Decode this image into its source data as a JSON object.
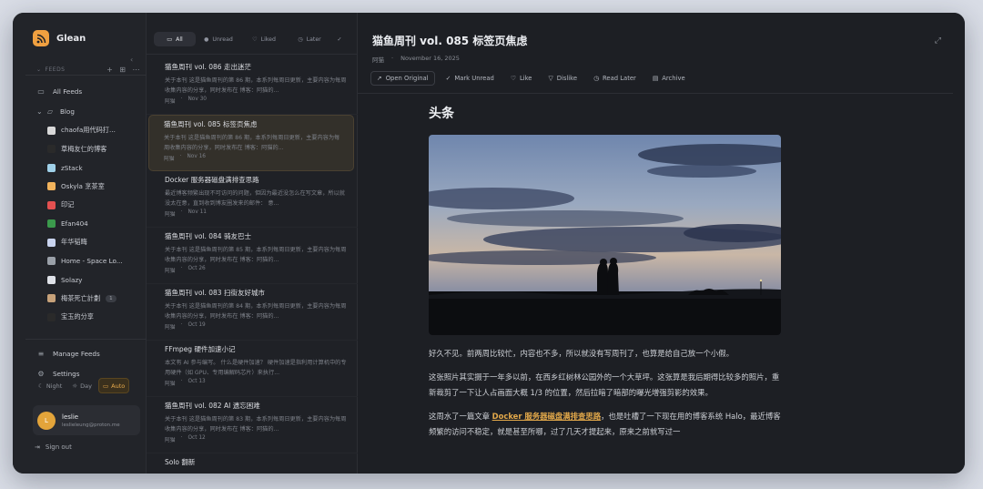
{
  "app": {
    "name": "Glean",
    "logo_icon": "rss-icon",
    "accent": "#f0a040"
  },
  "sidebar": {
    "feeds_label": "FEEDS",
    "all_feeds": "All Feeds",
    "folder": "Blog",
    "feeds": [
      {
        "name": "chaofa用代码打...",
        "color": "#d8d8d8"
      },
      {
        "name": "草梅友仁的博客",
        "color": "#2a2a2a"
      },
      {
        "name": "zStack",
        "color": "#9fd0e8"
      },
      {
        "name": "Oskyla 烹茶室",
        "color": "#f2b35c"
      },
      {
        "name": "印记",
        "color": "#e35050"
      },
      {
        "name": "Efan404",
        "color": "#3b9a4c"
      },
      {
        "name": "年华韬晦",
        "color": "#c9d4ef"
      },
      {
        "name": "Home - Space Lo...",
        "color": "#9aa0a8"
      },
      {
        "name": "Solazy",
        "color": "#dfe2e8"
      },
      {
        "name": "梅茶死亡計劃",
        "color": "#c7a27a",
        "badge": "1"
      },
      {
        "name": "宝玉的分享",
        "color": "#2a2a2a"
      }
    ],
    "manage_feeds": "Manage Feeds",
    "settings": "Settings",
    "theme": {
      "night": "Night",
      "day": "Day",
      "auto": "Auto"
    },
    "user": {
      "initial": "L",
      "name": "leslie",
      "email": "leslieleung@proton.me"
    },
    "sign_out": "Sign out"
  },
  "list": {
    "filters": {
      "all": "All",
      "unread": "Unread",
      "liked": "Liked",
      "later": "Later"
    },
    "items": [
      {
        "title": "猫鱼周刊 vol. 086 走出迷茫",
        "excerpt": "关于本刊 这是猫鱼周刊的第 86 期，本系列每周日更新，主要内容为每周收集内容的分享，同时发布在 博客：阿猫的...",
        "author": "阿猫",
        "date": "Nov 30"
      },
      {
        "title": "猫鱼周刊 vol. 085 标签页焦虑",
        "excerpt": "关于本刊 这是猫鱼周刊的第 86 期，本系列每周日更新，主要内容为每周收集内容的分享，同时发布在 博客：阿猫的...",
        "author": "阿猫",
        "date": "Nov 16"
      },
      {
        "title": "Docker 服务器磁盘满排查思路",
        "excerpt": "最近博客频繁出现不可访问的问题，但因为最近没怎么在写文章，所以就没太在意，直到收到博友圈发来的邮件： 意...",
        "author": "阿猫",
        "date": "Nov 11"
      },
      {
        "title": "猫鱼周刊 vol. 084 骑友巴士",
        "excerpt": "关于本刊 这是猫鱼周刊的第 85 期，本系列每周日更新，主要内容为每周收集内容的分享，同时发布在 博客：阿猫的...",
        "author": "阿猫",
        "date": "Oct 26"
      },
      {
        "title": "猫鱼周刊 vol. 083 扫街友好城市",
        "excerpt": "关于本刊 这是猫鱼周刊的第 84 期，本系列每周日更新，主要内容为每周收集内容的分享，同时发布在 博客：阿猫的...",
        "author": "阿猫",
        "date": "Oct 19"
      },
      {
        "title": "FFmpeg 硬件加速小记",
        "excerpt": "本文有 AI 参与编写。 什么是硬件加速？ 硬件加速是指利用计算机中的专用硬件（如 GPU、专用编解码芯片）来执行...",
        "author": "阿猫",
        "date": "Oct 13"
      },
      {
        "title": "猫鱼周刊 vol. 082 AI 遗忘困难",
        "excerpt": "关于本刊 这是猫鱼周刊的第 83 期，本系列每周日更新，主要内容为每周收集内容的分享，同时发布在 博客：阿猫的...",
        "author": "阿猫",
        "date": "Oct 12"
      },
      {
        "title": "Solo 翻新",
        "excerpt": "",
        "author": "",
        "date": ""
      }
    ]
  },
  "reader": {
    "title": "猫鱼周刊 vol. 085 标签页焦虑",
    "author": "阿猫",
    "date": "November 16, 2025",
    "actions": {
      "open_original": "Open Original",
      "mark_unread": "Mark Unread",
      "like": "Like",
      "dislike": "Dislike",
      "read_later": "Read Later",
      "archive": "Archive"
    },
    "heading": "头条",
    "para1": "好久不见。前两周比较忙，内容也不多，所以就没有写周刊了，也算是给自己放一个小假。",
    "para2": "这张照片其实摄于一年多以前，在西乡红树林公园外的一个大草坪。这张算是我后期得比较多的照片，重新裁剪了一下让人占画面大概 1/3 的位置，然后拉暗了暗部的曝光增强剪影的效果。",
    "para3_before": "这周水了一篇文章 ",
    "para3_link": "Docker 服务器磁盘满排查思路",
    "para3_after": "，也是吐槽了一下现在用的博客系统 Halo，最近博客频繁的访问不稳定，就是甚至所哪，过了几天才提起来，原来之前就写过一"
  }
}
